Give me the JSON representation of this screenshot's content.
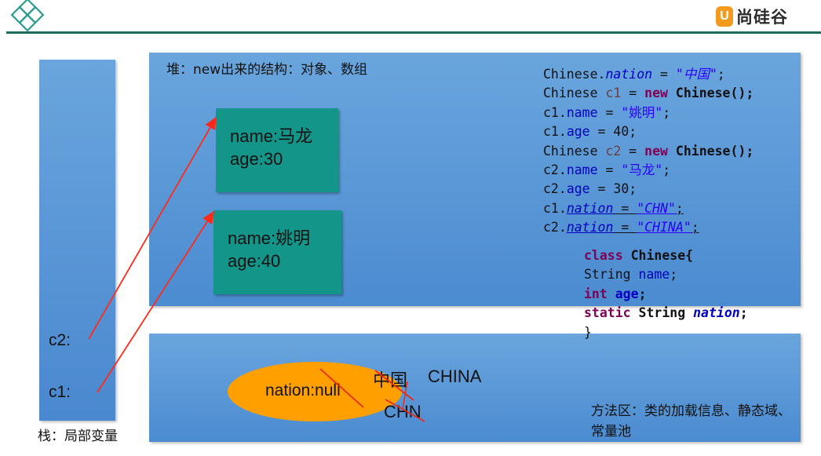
{
  "brand": {
    "mark": "U",
    "name": "尚硅谷"
  },
  "stack": {
    "title": "栈：局部变量",
    "vars": [
      "c2:",
      "c1:"
    ]
  },
  "heap": {
    "title": "堆：new出来的结构：对象、数组",
    "objects": [
      {
        "name": "name:马龙",
        "age": "age:30"
      },
      {
        "name": "name:姚明",
        "age": "age:40"
      }
    ]
  },
  "method_area": {
    "title": "方法区：类的加载信息、静态域、常量池",
    "static_field": "nation:null",
    "values": [
      "中国",
      "CHINA",
      "CHN"
    ]
  },
  "code": {
    "line1": {
      "a": "Chinese.",
      "b": "nation",
      "c": " = ",
      "d": "\"中国\"",
      "e": ";"
    },
    "line2": {
      "a": "Chinese ",
      "b": "c1",
      "c": " = ",
      "d": "new",
      "e": " ",
      "f": "Chinese()",
      "g": ";"
    },
    "line3": {
      "a": "c1.",
      "b": "name",
      "c": " = ",
      "d": "\"姚明\"",
      "e": ";"
    },
    "line4": {
      "a": "c1.",
      "b": "age",
      "c": " = 40;"
    },
    "line5": {
      "a": "Chinese ",
      "b": "c2",
      "c": " = ",
      "d": "new",
      "e": " ",
      "f": "Chinese()",
      "g": ";"
    },
    "line6": {
      "a": "c2.",
      "b": "name",
      "c": " = ",
      "d": "\"马龙\"",
      "e": ";"
    },
    "line7": {
      "a": "c2.",
      "b": "age",
      "c": " = 30;"
    },
    "line8": {
      "a": "c1.",
      "b": "nation",
      "c": " = ",
      "d": "\"CHN\"",
      "e": ";"
    },
    "line9": {
      "a": "c2.",
      "b": "nation",
      "c": " = ",
      "d": "\"CHINA\"",
      "e": ";"
    },
    "class_def": {
      "l1": {
        "a": "class",
        "b": " Chinese{"
      },
      "l2": {
        "a": "String ",
        "b": "name",
        "c": ";"
      },
      "l3": {
        "a": "int",
        "b": " ",
        "c": "age",
        "d": ";"
      },
      "l4": {
        "a": "static",
        "b": " String ",
        "c": "nation",
        "d": ";"
      },
      "l5": "}"
    }
  },
  "colors": {
    "panel": "#5a98d8",
    "object": "#14958a",
    "ellipse": "#ffa000",
    "arrow": "#ff2a1a",
    "header_line": "#1d6b5a"
  },
  "icons": [
    "diamond-logo-icon",
    "brand-logo-icon"
  ]
}
